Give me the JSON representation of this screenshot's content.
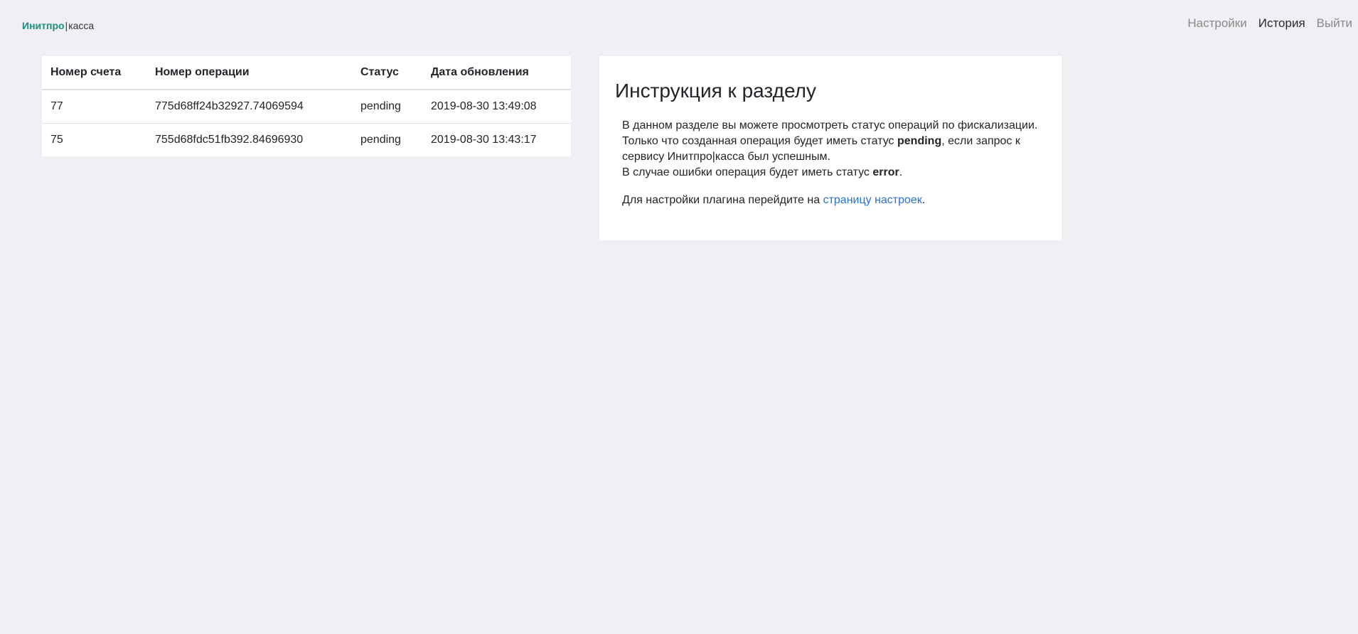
{
  "header": {
    "logo_brand": "Инитпро",
    "logo_separator": "|",
    "logo_product": "касса",
    "nav": [
      {
        "label": "Настройки",
        "active": false
      },
      {
        "label": "История",
        "active": true
      },
      {
        "label": "Выйти",
        "active": false
      }
    ]
  },
  "history_table": {
    "columns": [
      "Номер счета",
      "Номер операции",
      "Статус",
      "Дата обновления"
    ],
    "rows": [
      {
        "invoice": "77",
        "operation": "775d68ff24b32927.74069594",
        "status": "pending",
        "updated": "2019-08-30 13:49:08"
      },
      {
        "invoice": "75",
        "operation": "755d68fdc51fb392.84696930",
        "status": "pending",
        "updated": "2019-08-30 13:43:17"
      }
    ]
  },
  "instructions": {
    "title": "Инструкция к разделу",
    "p1_text1": "В данном разделе вы можете просмотреть статус операций по фискализации. Только что созданная операция будет иметь статус ",
    "p1_status_pending": "pending",
    "p1_text2": ", если запрос к сервису Инитпро|касса был успешным.",
    "p1_text3": "В случае ошибки операция будет иметь статус ",
    "p1_status_error": "error",
    "p1_text4": ".",
    "p2_text1": "Для настройки плагина перейдите на ",
    "p2_link": "страницу настроек",
    "p2_text2": "."
  },
  "colors": {
    "brand": "#1c8f80",
    "link": "#2a73cf",
    "background": "#efeff4"
  }
}
